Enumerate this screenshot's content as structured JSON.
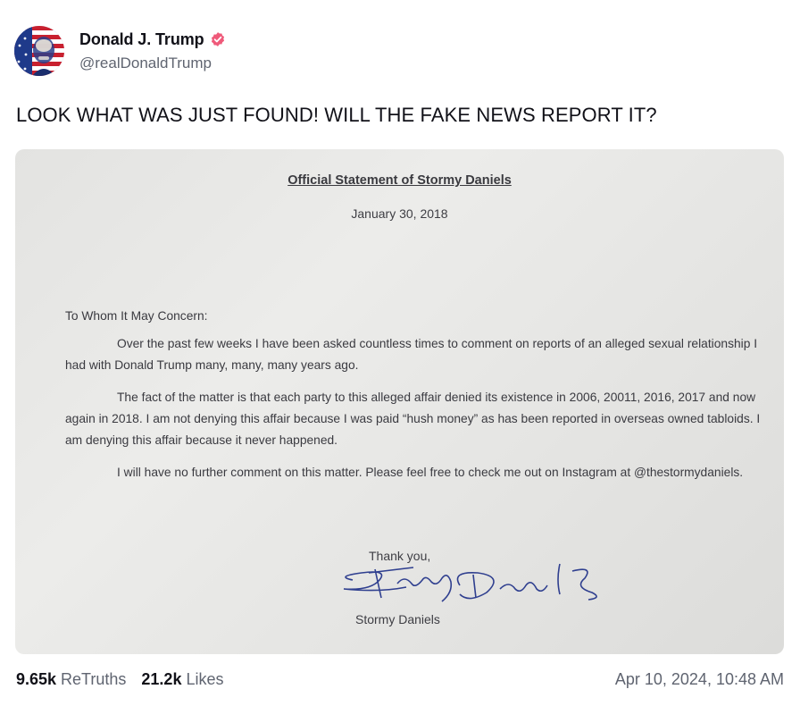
{
  "author": {
    "display_name": "Donald J. Trump",
    "handle": "@realDonaldTrump",
    "verified_icon": "verified-badge-icon",
    "verified_color": "#ef5a7a"
  },
  "post": {
    "text": "LOOK WHAT WAS JUST FOUND! WILL THE FAKE NEWS REPORT IT?"
  },
  "document": {
    "title": "Official Statement of Stormy Daniels",
    "date": "January 30, 2018",
    "salutation": "To Whom It May Concern:",
    "paragraph_1": "Over the past few weeks I have been asked countless times to comment on reports of an alleged sexual relationship I had with Donald Trump many, many, many years ago.",
    "paragraph_2": "The fact of the matter is that each party to this alleged affair denied its existence in 2006, 20011, 2016, 2017 and now again in 2018. I am not denying this affair because I was paid “hush money” as has been reported in overseas owned tabloids. I am denying this affair because it never happened.",
    "paragraph_3": "I will have no further comment on this matter. Please feel free to check me out on Instagram at @thestormydaniels.",
    "closing": "Thank you,",
    "signature": "Stormy Daniels",
    "signer_name": "Stormy Daniels"
  },
  "stats": {
    "retruths_count": "9.65k",
    "retruths_label": "ReTruths",
    "likes_count": "21.2k",
    "likes_label": "Likes"
  },
  "timestamp": "Apr 10, 2024, 10:48 AM",
  "colors": {
    "text_primary": "#111118",
    "text_secondary": "#5f6470",
    "signature_ink": "#2f3f8f"
  }
}
